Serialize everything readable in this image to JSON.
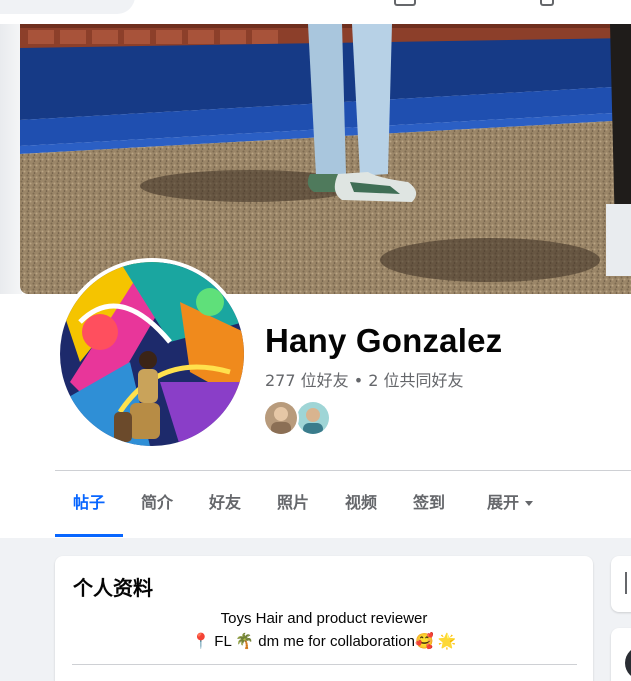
{
  "profile": {
    "name": "Hany Gonzalez",
    "friend_count": "277 位好友",
    "separator": " • ",
    "mutual_friends": "2 位共同好友"
  },
  "tabs": [
    {
      "label": "帖子",
      "active": true
    },
    {
      "label": "简介",
      "active": false
    },
    {
      "label": "好友",
      "active": false
    },
    {
      "label": "照片",
      "active": false
    },
    {
      "label": "视频",
      "active": false
    },
    {
      "label": "签到",
      "active": false
    },
    {
      "label": "展开",
      "active": false
    }
  ],
  "intro": {
    "title": "个人资料",
    "bio_line1": "Toys Hair and product reviewer",
    "bio_line2": "📍 FL 🌴 dm me for collaboration🥰 🌟"
  },
  "colors": {
    "accent": "#0866ff",
    "secondary_text": "#65676b",
    "feed_background": "#f0f2f5"
  },
  "icons": [
    "chevron-down-icon",
    "location-pin-emoji",
    "palm-tree-emoji",
    "smiling-face-emoji",
    "star-emoji"
  ]
}
